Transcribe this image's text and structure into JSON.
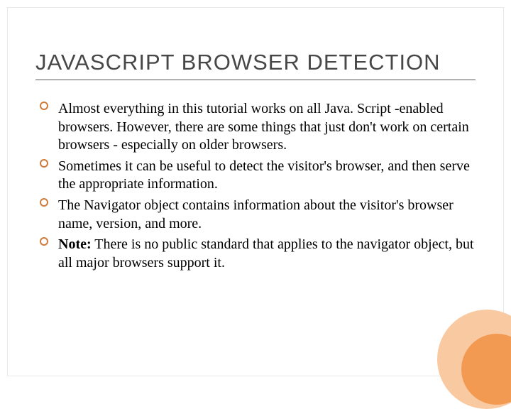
{
  "title": "JAVASCRIPT BROWSER DETECTION",
  "bullets": [
    {
      "text": "Almost everything in this tutorial works on all Java. Script -enabled browsers. However, there are some things that just don't work on certain browsers - especially on older browsers."
    },
    {
      "text": "Sometimes it can be useful to detect the visitor's browser, and then serve the appropriate information."
    },
    {
      "text": "The Navigator object contains information about the visitor's browser name, version, and more."
    },
    {
      "note_label": "Note:",
      "text": " There is no public standard that applies to the navigator object, but all major browsers support it."
    }
  ]
}
